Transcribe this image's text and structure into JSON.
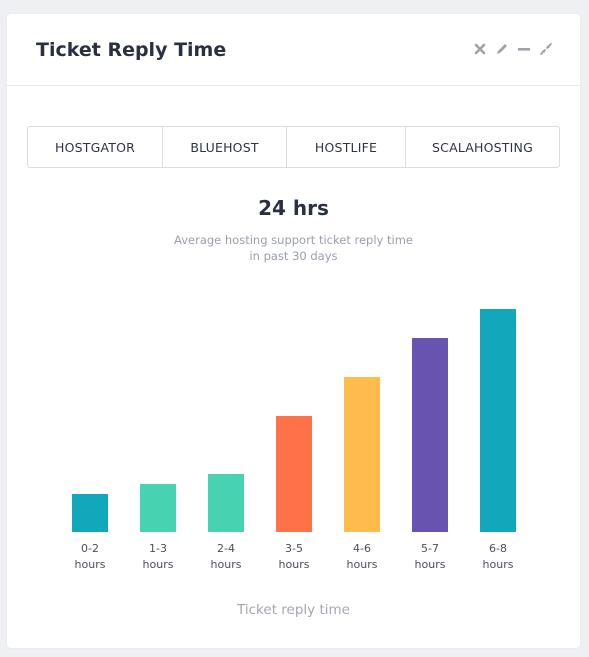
{
  "widget": {
    "title": "Ticket Reply Time",
    "toolbar": [
      "close-icon",
      "edit-icon",
      "minimize-icon",
      "collapse-icon"
    ]
  },
  "tabs": [
    "HOSTGATOR",
    "BLUEHOST",
    "HOSTLIFE",
    "SCALAHOSTING"
  ],
  "summary": {
    "value": "24 hrs",
    "subtitle_line1": "Average hosting support ticket reply time",
    "subtitle_line2": "in past 30 days"
  },
  "chart_data": {
    "type": "bar",
    "categories": [
      [
        "0-2",
        "hours"
      ],
      [
        "1-3",
        "hours"
      ],
      [
        "2-4",
        "hours"
      ],
      [
        "3-5",
        "hours"
      ],
      [
        "4-6",
        "hours"
      ],
      [
        "5-7",
        "hours"
      ],
      [
        "6-8",
        "hours"
      ]
    ],
    "values": [
      38,
      48,
      58,
      116,
      155,
      194,
      223
    ],
    "colors": [
      "#12a8bb",
      "#46d3b1",
      "#46d3b1",
      "#ff7148",
      "#ffbb4b",
      "#6853b1",
      "#12a8bb"
    ],
    "xlabel": "Ticket reply time",
    "ylabel": "",
    "ylim": [
      0,
      223
    ],
    "grid": false,
    "legend": "none"
  }
}
